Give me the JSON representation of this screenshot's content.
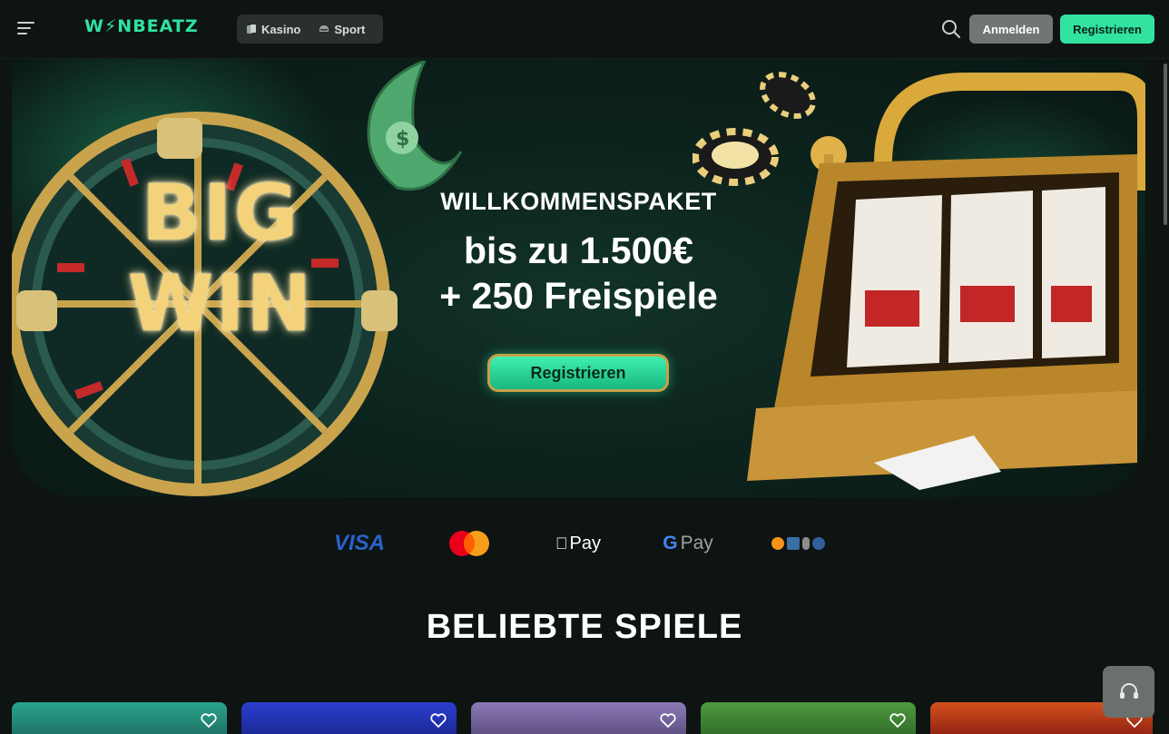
{
  "header": {
    "logo": "W⚡NBEATZ",
    "nav": [
      {
        "label": "Kasino",
        "icon": "cards-icon"
      },
      {
        "label": "Sport",
        "icon": "sport-helmet-icon"
      }
    ],
    "login_label": "Anmelden",
    "register_label": "Registrieren"
  },
  "hero": {
    "subtitle": "WILLKOMMENSPAKET",
    "line1": "bis zu 1.500€",
    "line2": "+ 250 Freispiele",
    "cta_label": "Registrieren",
    "art_left": "BIG WIN",
    "accent_color": "#32e3a0"
  },
  "payments": {
    "visa": "VISA",
    "applepay": "Pay",
    "googlepay": "Pay"
  },
  "games_section": {
    "title": "BELIEBTE SPIELE"
  },
  "colors": {
    "background": "#0d1412",
    "accent": "#32e3a0",
    "secondary_button": "#6f7674"
  }
}
